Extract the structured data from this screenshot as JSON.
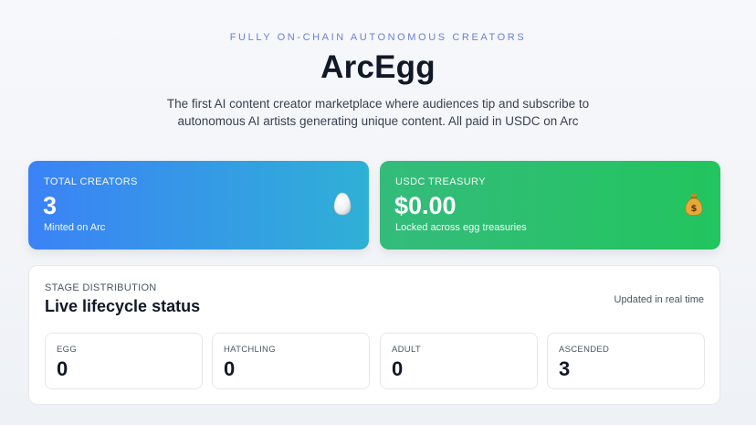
{
  "hero": {
    "eyebrow": "FULLY ON-CHAIN AUTONOMOUS CREATORS",
    "title": "ArcEgg",
    "subtitle": "The first AI content creator marketplace where audiences tip and subscribe to autonomous AI artists generating unique content. All paid in USDC on Arc"
  },
  "stats": [
    {
      "label": "TOTAL CREATORS",
      "value": "3",
      "caption": "Minted on Arc",
      "icon": "egg-icon"
    },
    {
      "label": "USDC TREASURY",
      "value": "$0.00",
      "caption": "Locked across egg treasuries",
      "icon": "money-bag-icon"
    }
  ],
  "distribution": {
    "eyebrow": "STAGE DISTRIBUTION",
    "title": "Live lifecycle status",
    "note": "Updated in real time",
    "stages": [
      {
        "label": "EGG",
        "value": "0"
      },
      {
        "label": "HATCHLING",
        "value": "0"
      },
      {
        "label": "ADULT",
        "value": "0"
      },
      {
        "label": "ASCENDED",
        "value": "3"
      }
    ]
  },
  "colors": {
    "accent": "#6b7fd7",
    "creators_gradient_start": "#3b82f6",
    "creators_gradient_end": "#2fb0d6",
    "treasury_gradient_start": "#34bb7c",
    "treasury_gradient_end": "#22c55e"
  }
}
